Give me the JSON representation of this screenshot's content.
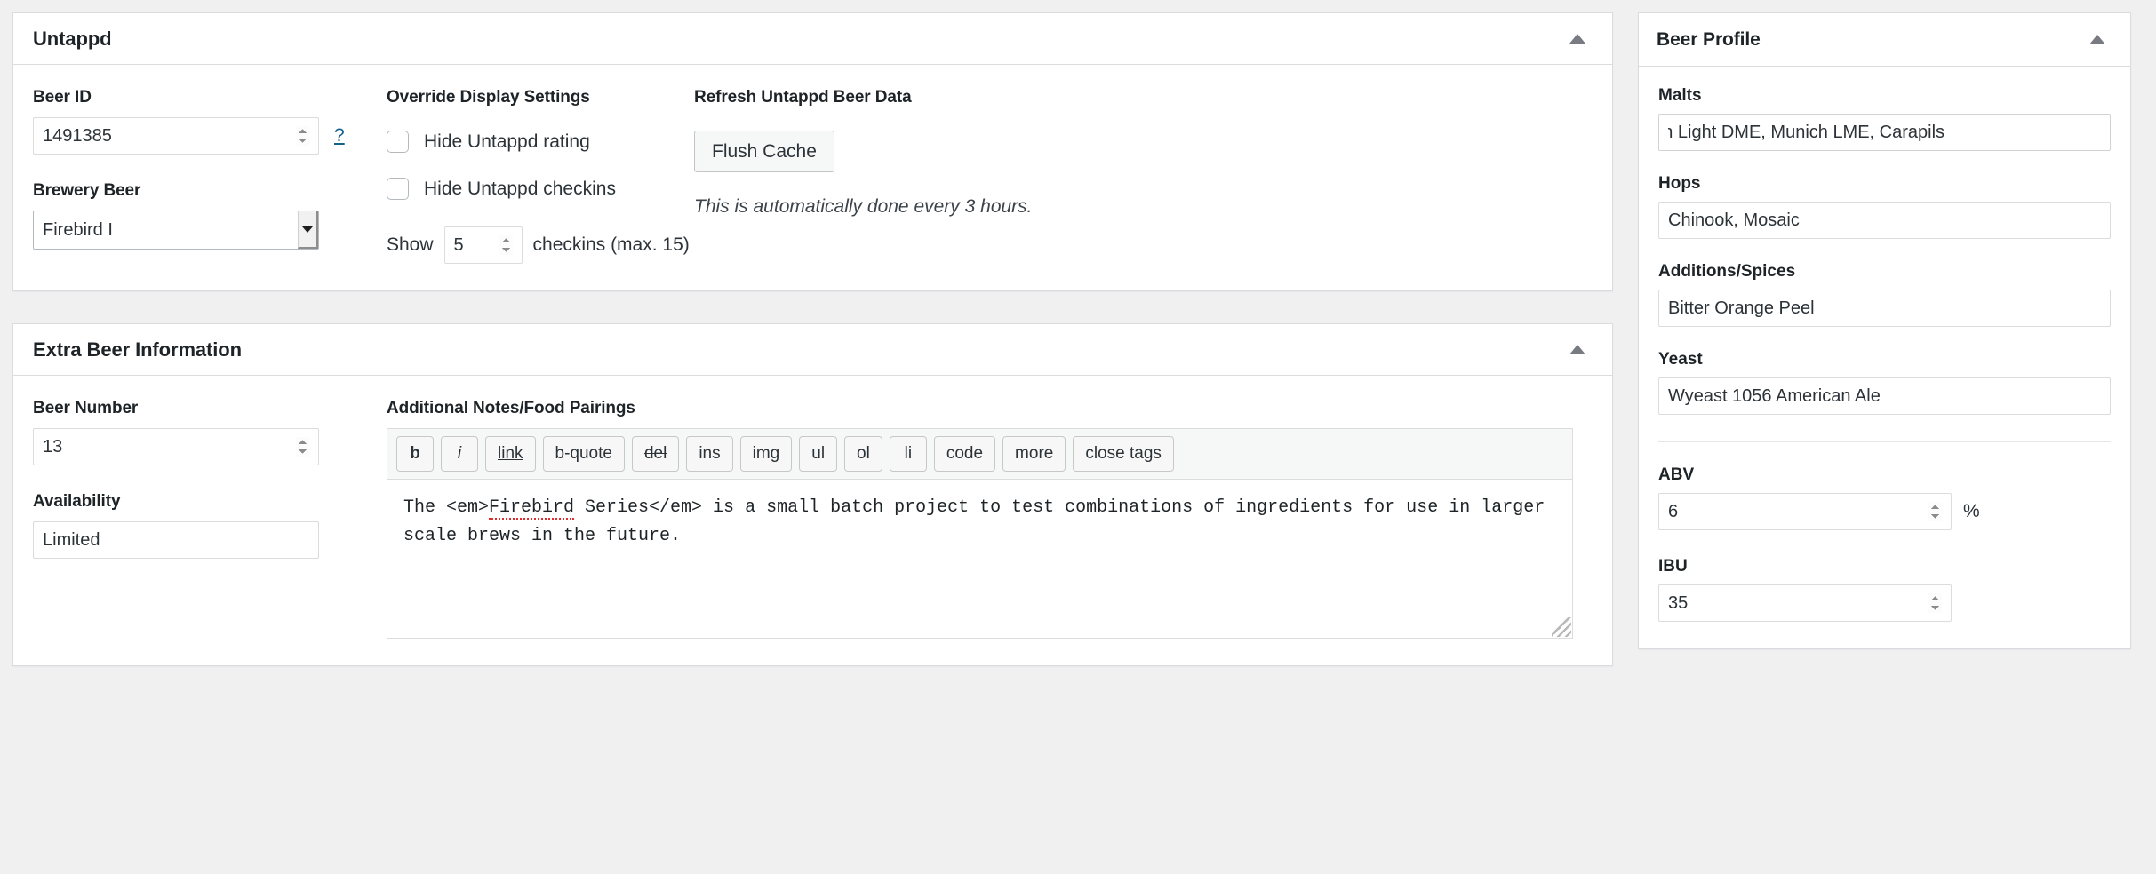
{
  "untappd_box": {
    "title": "Untappd",
    "beer_id": {
      "label": "Beer ID",
      "value": "1491385",
      "help_link": "?"
    },
    "brewery_beer": {
      "label": "Brewery Beer",
      "value": "Firebird I",
      "options": [
        "Firebird I"
      ]
    },
    "override": {
      "heading": "Override Display Settings",
      "hide_rating_label": "Hide Untappd rating",
      "hide_rating_checked": false,
      "hide_checkins_label": "Hide Untappd checkins",
      "hide_checkins_checked": false,
      "show_prefix": "Show",
      "show_value": "5",
      "show_suffix": "checkins (max. 15)"
    },
    "refresh": {
      "heading": "Refresh Untappd Beer Data",
      "flush_button": "Flush Cache",
      "note": "This is automatically done every 3 hours."
    }
  },
  "extra_box": {
    "title": "Extra Beer Information",
    "beer_number": {
      "label": "Beer Number",
      "value": "13"
    },
    "availability": {
      "label": "Availability",
      "value": "Limited"
    },
    "notes": {
      "label": "Additional Notes/Food Pairings",
      "toolbar": [
        {
          "name": "b",
          "label": "b",
          "style": "b"
        },
        {
          "name": "i",
          "label": "i",
          "style": "i"
        },
        {
          "name": "link",
          "label": "link",
          "style": "u"
        },
        {
          "name": "b-quote",
          "label": "b-quote",
          "style": ""
        },
        {
          "name": "del",
          "label": "del",
          "style": "s"
        },
        {
          "name": "ins",
          "label": "ins",
          "style": ""
        },
        {
          "name": "img",
          "label": "img",
          "style": ""
        },
        {
          "name": "ul",
          "label": "ul",
          "style": ""
        },
        {
          "name": "ol",
          "label": "ol",
          "style": ""
        },
        {
          "name": "li",
          "label": "li",
          "style": ""
        },
        {
          "name": "code",
          "label": "code",
          "style": ""
        },
        {
          "name": "more",
          "label": "more",
          "style": ""
        },
        {
          "name": "close-tags",
          "label": "close tags",
          "style": ""
        }
      ],
      "text_part1": "The <em>",
      "text_misspelled": "Firebird",
      "text_part2": " Series</em> is a small batch project to test combinations of ingredients for use in larger scale brews in the future."
    }
  },
  "beer_profile": {
    "title": "Beer Profile",
    "fields": [
      {
        "label": "Malts",
        "value": "den Light DME, Munich LME, Carapils",
        "clipped": true
      },
      {
        "label": "Hops",
        "value": "Chinook, Mosaic",
        "clipped": false
      },
      {
        "label": "Additions/Spices",
        "value": "Bitter Orange Peel",
        "clipped": false
      },
      {
        "label": "Yeast",
        "value": "Wyeast 1056 American Ale",
        "clipped": false
      }
    ],
    "abv": {
      "label": "ABV",
      "value": "6",
      "unit": "%"
    },
    "ibu": {
      "label": "IBU",
      "value": "35"
    }
  },
  "icons": {
    "collapse": "caret-up-icon",
    "dropdown": "chevron-down-icon"
  },
  "colors": {
    "page_bg": "#f0f0f1",
    "panel_bg": "#ffffff",
    "border": "#dcdcde",
    "title": "#1d2327",
    "link": "#14628c",
    "spellcheck": "#e02c2c"
  }
}
